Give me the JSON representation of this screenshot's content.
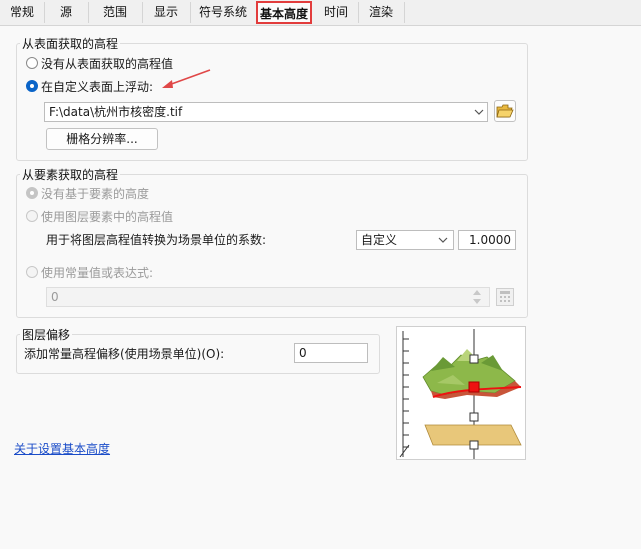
{
  "tabs": [
    {
      "label": "常规"
    },
    {
      "label": "源"
    },
    {
      "label": "范围"
    },
    {
      "label": "显示"
    },
    {
      "label": "符号系统"
    },
    {
      "label": "基本高度"
    },
    {
      "label": "时间"
    },
    {
      "label": "渲染"
    }
  ],
  "surface_group": {
    "title": "从表面获取的高程",
    "option_none": "没有从表面获取的高程值",
    "option_float": "在自定义表面上浮动:",
    "surface_path": "F:\\data\\杭州市核密度.tif",
    "raster_resolution_button": "栅格分辨率..."
  },
  "feature_group": {
    "title": "从要素获取的高程",
    "option_none": "没有基于要素的高度",
    "option_layer_field": "使用图层要素中的高程值",
    "conversion_label": "用于将图层高程值转换为场景单位的系数:",
    "conversion_unit": "自定义",
    "conversion_factor": "1.0000",
    "option_expression": "使用常量值或表达式:",
    "expression_value": "0"
  },
  "offset_group": {
    "title": "图层偏移",
    "offset_label": "添加常量高程偏移(使用场景单位)(O):",
    "offset_value": "0"
  },
  "help_link": "关于设置基本高度",
  "colors": {
    "accent": "#0a64c8",
    "tab_highlight": "#e23c3c",
    "annotation_arrow": "#e04848",
    "terrain_green": "#8db84a",
    "base_tan": "#e8c77a",
    "marker_red": "#ee1111"
  },
  "icons": {
    "browse": "folder-open-icon",
    "calculator": "calculator-icon",
    "dropdown": "chevron-down-icon"
  }
}
